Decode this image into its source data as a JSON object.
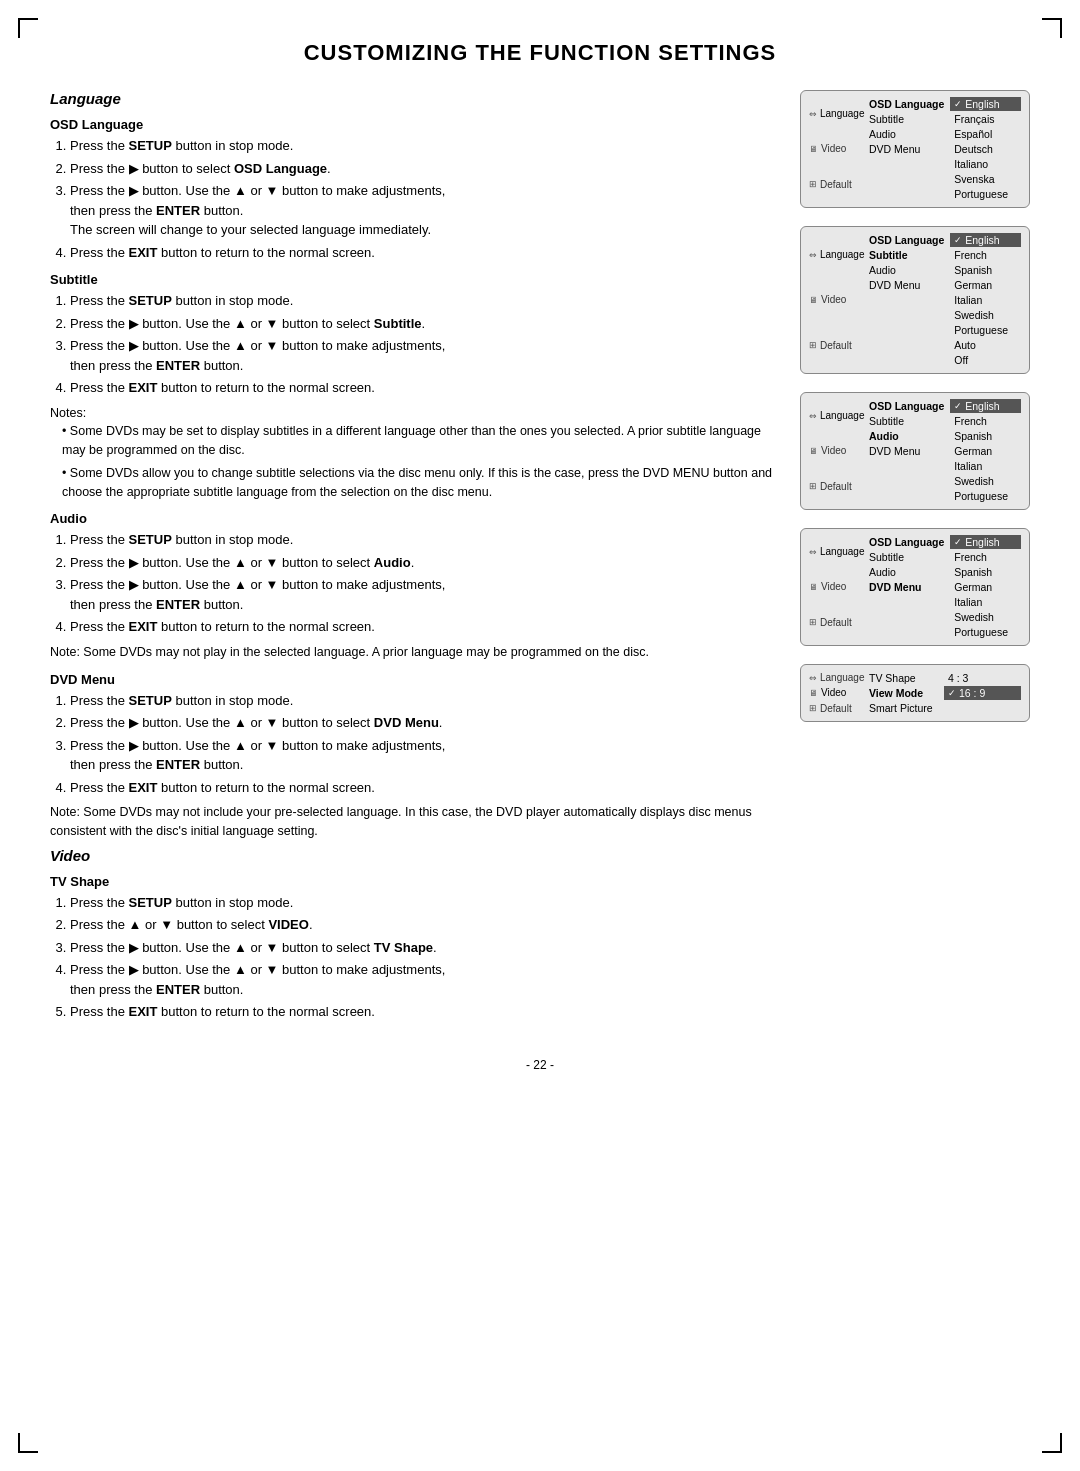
{
  "page": {
    "title": "CUSTOMIZING THE FUNCTION SETTINGS",
    "page_number": "- 22 -"
  },
  "sections": {
    "language": {
      "title": "Language",
      "osd_language": {
        "heading": "OSD Language",
        "steps": [
          "Press the <b>SETUP</b> button in stop mode.",
          "Press the ▶ button to select <b>OSD Language</b>.",
          "Press the ▶ button. Use the ▲ or ▼ button to make adjustments, then press the <b>ENTER</b> button.",
          "The screen will change to your selected language immediately.",
          "Press the <b>EXIT</b> button to return to the normal screen."
        ]
      },
      "subtitle": {
        "heading": "Subtitle",
        "steps": [
          "Press the <b>SETUP</b> button in stop mode.",
          "Press the ▶ button. Use the ▲ or ▼ button to select <b>Subtitle</b>.",
          "Press the ▶ button. Use the ▲ or ▼ button to make adjustments, then press the <b>ENTER</b> button.",
          "Press the <b>EXIT</b> button to return to the normal screen."
        ],
        "notes_label": "Notes:",
        "notes": [
          "Some DVDs may be set to display subtitles in a different language other than the ones you selected. A prior subtitle language may be programmed on the disc.",
          "Some DVDs allow you to change subtitle selections via the disc menu only. If this is the case, press the DVD MENU button and choose the appropriate subtitle language from the selection on the disc menu."
        ]
      },
      "audio": {
        "heading": "Audio",
        "steps": [
          "Press the <b>SETUP</b> button in stop mode.",
          "Press the ▶ button. Use the ▲ or ▼ button to select <b>Audio</b>.",
          "Press the ▶ button. Use the ▲ or ▼ button to make adjustments, then press the <b>ENTER</b> button.",
          "Press the <b>EXIT</b> button to return to the normal screen."
        ],
        "note": "Note: Some DVDs may not play in the selected language. A prior language may be programmed on the disc."
      },
      "dvd_menu": {
        "heading": "DVD Menu",
        "steps": [
          "Press the <b>SETUP</b> button in stop mode.",
          "Press the ▶ button. Use the ▲ or ▼ button to select <b>DVD Menu</b>.",
          "Press the ▶ button. Use the ▲ or ▼ button to make adjustments, then press the <b>ENTER</b> button.",
          "Press the <b>EXIT</b> button to return to the normal screen."
        ],
        "note": "Note: Some DVDs may not include your pre-selected language. In this case, the DVD player automatically displays disc menus consistent with the disc's initial language setting."
      }
    },
    "video": {
      "title": "Video",
      "tv_shape": {
        "heading": "TV Shape",
        "steps": [
          "Press the <b>SETUP</b> button in stop mode.",
          "Press the ▲ or ▼ button to select <b>VIDEO</b>.",
          "Press the ▶ button. Use the ▲ or ▼ button to select <b>TV Shape</b>.",
          "Press the ▶ button. Use the ▲ or ▼ button to make adjustments, then press the <b>ENTER</b> button.",
          "Press the <b>EXIT</b> button to return to the normal screen."
        ]
      }
    }
  },
  "panels": {
    "osd_language": {
      "sidebar": [
        {
          "icon": "⇔",
          "label": "Language",
          "active": true
        },
        {
          "icon": "📺",
          "label": "Video",
          "active": false
        },
        {
          "icon": "⊞",
          "label": "Default",
          "active": false
        }
      ],
      "col1": {
        "label": "OSD Language",
        "options": [
          "Subtitle",
          "Audio",
          "DVD Menu"
        ]
      },
      "col2": {
        "selected": "English",
        "options": [
          "Français",
          "Español",
          "Deutsch",
          "Italiano",
          "Svenska",
          "Portuguese"
        ]
      }
    },
    "subtitle": {
      "sidebar": [
        {
          "icon": "⇔",
          "label": "Language",
          "active": true
        },
        {
          "icon": "📺",
          "label": "Video",
          "active": false
        },
        {
          "icon": "⊞",
          "label": "Default",
          "active": false
        }
      ],
      "col1": {
        "selected": "OSD Language",
        "options": [
          "Subtitle",
          "Audio",
          "DVD Menu"
        ]
      },
      "col2": {
        "selected": "English",
        "options": [
          "French",
          "Spanish",
          "German",
          "Italian",
          "Swedish",
          "Portuguese",
          "Auto",
          "Off"
        ]
      }
    },
    "audio": {
      "sidebar": [
        {
          "icon": "⇔",
          "label": "Language",
          "active": true
        },
        {
          "icon": "📺",
          "label": "Video",
          "active": false
        },
        {
          "icon": "⊞",
          "label": "Default",
          "active": false
        }
      ],
      "col1": {
        "label": "OSD Language",
        "options": [
          "Subtitle",
          "Audio",
          "DVD Menu"
        ],
        "selected_row": "Audio"
      },
      "col2": {
        "selected": "English",
        "options": [
          "French",
          "Spanish",
          "German",
          "Italian",
          "Swedish",
          "Portuguese"
        ]
      }
    },
    "dvd_menu": {
      "sidebar": [
        {
          "icon": "⇔",
          "label": "Language",
          "active": true
        },
        {
          "icon": "📺",
          "label": "Video",
          "active": false
        },
        {
          "icon": "⊞",
          "label": "Default",
          "active": false
        }
      ],
      "col1": {
        "label": "OSD Language",
        "options": [
          "Subtitle",
          "Audio",
          "DVD Menu"
        ],
        "selected_row": "DVD Menu"
      },
      "col2": {
        "selected": "English",
        "options": [
          "French",
          "Spanish",
          "German",
          "Italian",
          "Swedish",
          "Portuguese"
        ]
      }
    },
    "video_panel": {
      "sidebar": [
        {
          "icon": "⇔",
          "label": "Language",
          "active": false
        },
        {
          "icon": "📺",
          "label": "Video",
          "active": true
        },
        {
          "icon": "⊞",
          "label": "Default",
          "active": false
        }
      ],
      "col1": {
        "options": [
          "TV Shape",
          "View Mode",
          "Smart Picture"
        ],
        "selected_row": "View Mode"
      },
      "col2": {
        "options": [
          "4 : 3",
          "16 : 9"
        ],
        "selected": "16 : 9"
      }
    }
  }
}
